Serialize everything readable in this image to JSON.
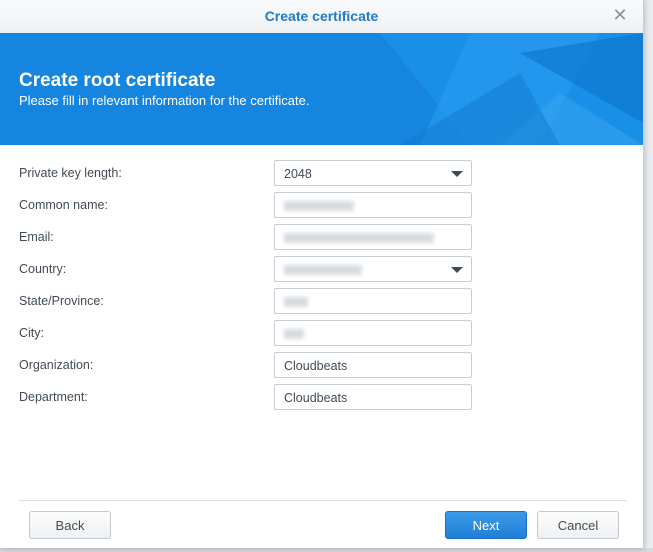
{
  "window": {
    "title": "Create certificate"
  },
  "banner": {
    "title": "Create root certificate",
    "subtitle": "Please fill in relevant information for the certificate."
  },
  "form": {
    "fields": [
      {
        "label": "Private key length:",
        "value": "2048",
        "type": "select"
      },
      {
        "label": "Common name:",
        "value": "",
        "type": "text"
      },
      {
        "label": "Email:",
        "value": "",
        "type": "text"
      },
      {
        "label": "Country:",
        "value": "",
        "type": "select"
      },
      {
        "label": "State/Province:",
        "value": "",
        "type": "text"
      },
      {
        "label": "City:",
        "value": "",
        "type": "text"
      },
      {
        "label": "Organization:",
        "value": "Cloudbeats",
        "type": "text"
      },
      {
        "label": "Department:",
        "value": "Cloudbeats",
        "type": "text"
      }
    ]
  },
  "buttons": {
    "back": "Back",
    "next": "Next",
    "cancel": "Cancel"
  },
  "colors": {
    "accent": "#1585e0",
    "title": "#1f7bc8",
    "primary_button": "#2a8ae0"
  }
}
